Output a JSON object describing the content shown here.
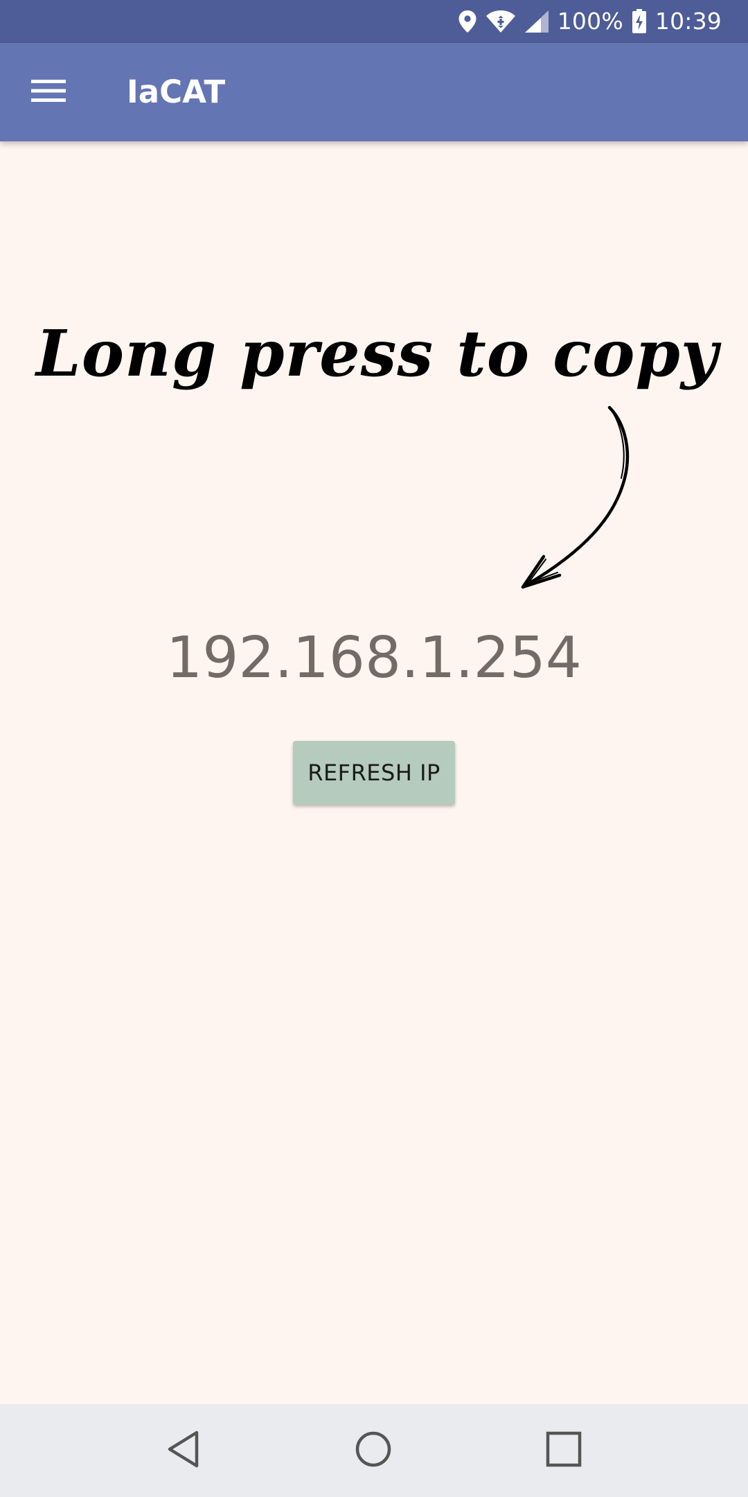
{
  "status_bar": {
    "battery": "100%",
    "time": "10:39",
    "icons": [
      "location-icon",
      "wifi-icon",
      "cell-signal-icon",
      "battery-charging-icon"
    ]
  },
  "app_bar": {
    "menu_icon": "hamburger-menu-icon",
    "title": "IaCAT"
  },
  "main": {
    "hint": "Long press to copy",
    "ip_address": "192.168.1.254",
    "refresh_button_label": "REFRESH IP"
  },
  "nav_bar": {
    "icons": [
      "back-icon",
      "home-icon",
      "recents-icon"
    ]
  },
  "colors": {
    "status_bar": "#4e5c98",
    "app_bar": "#6475b3",
    "background": "#fff5f0",
    "button": "#b5cbbd",
    "ip_text": "#726b68",
    "nav_bar": "#e9ebee"
  }
}
